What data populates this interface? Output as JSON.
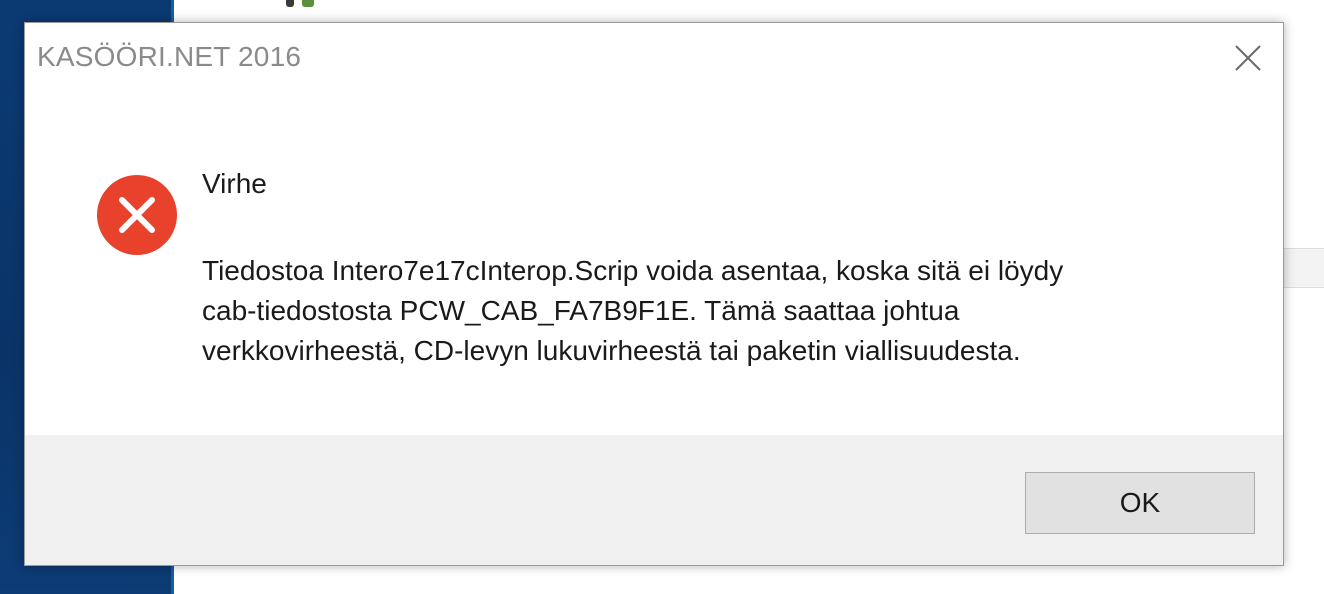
{
  "dialog": {
    "title": "KASÖÖRI.NET 2016",
    "heading": "Virhe",
    "message_lines": [
      "Tiedostoa Intero7e17cInterop.Scrip voida asentaa, koska sitä ei löydy",
      "cab-tiedostosta PCW_CAB_FA7B9F1E. Tämä saattaa johtua",
      "verkkovirheestä, CD-levyn lukuvirheestä tai paketin viallisuudesta."
    ],
    "ok_label": "OK",
    "icon": "error-icon",
    "colors": {
      "error_red": "#e8412c",
      "footer_gray": "#f0f0f0",
      "title_gray": "#8a8a8a"
    }
  }
}
